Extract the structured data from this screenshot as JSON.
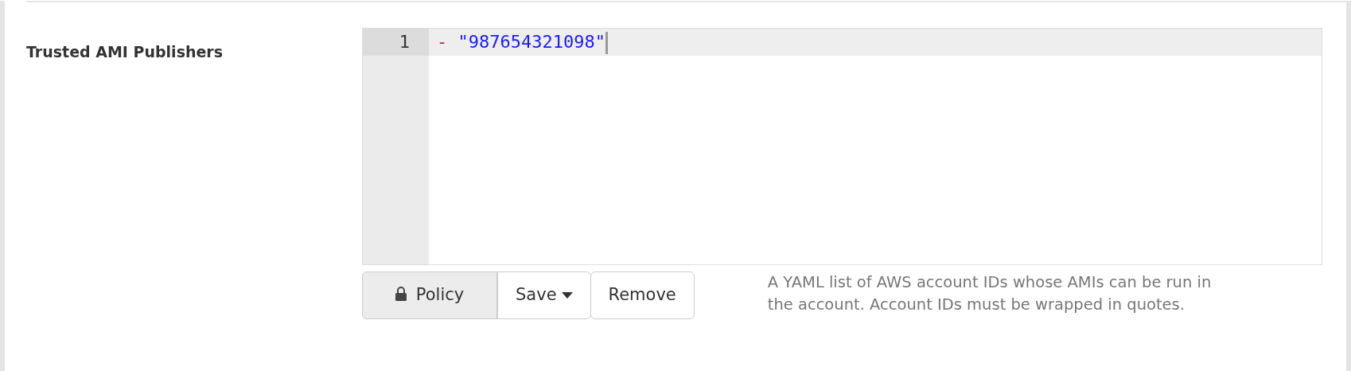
{
  "field": {
    "label": "Trusted AMI Publishers"
  },
  "editor": {
    "lines": [
      {
        "number": "1",
        "dash": "-",
        "value": "\"987654321098\"",
        "active": true,
        "cursor": true
      }
    ]
  },
  "buttons": [
    {
      "label": "Policy",
      "kind": "lock",
      "selected": true
    },
    {
      "label": "Save",
      "kind": "dropdown",
      "selected": false
    },
    {
      "label": "Remove",
      "kind": "plain",
      "selected": false
    }
  ],
  "help": "A YAML list of AWS account IDs whose AMIs can be run in the account. Account IDs must be wrapped in quotes."
}
